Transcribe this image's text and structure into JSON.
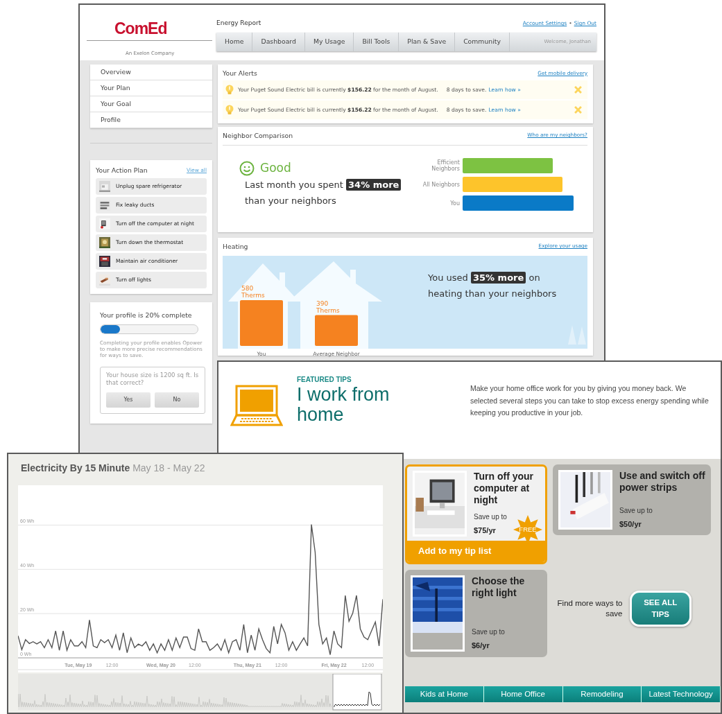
{
  "report_window": {
    "logo": {
      "name": "ComEd",
      "tagline": "An Exelon Company"
    },
    "title": "Energy Report",
    "account_links": [
      "Account Settings",
      "Sign Out"
    ],
    "link_separator": "•",
    "nav_tabs": [
      {
        "label": "Home",
        "selected": false
      },
      {
        "label": "Dashboard",
        "selected": false
      },
      {
        "label": "My Usage",
        "selected": false
      },
      {
        "label": "Bill Tools",
        "selected": false
      },
      {
        "label": "Plan & Save",
        "selected": false
      },
      {
        "label": "Community",
        "selected": false
      }
    ],
    "welcome": "Welcome, Jonathan",
    "side_nav": [
      "Overview",
      "Your Plan",
      "Your Goal",
      "Profile"
    ],
    "action_plan": {
      "title": "Your Action Plan",
      "view_all": "View all",
      "items": [
        "Unplug spare refrigerator",
        "Fix leaky ducts",
        "Turn off the computer at night",
        "Turn down the thermostat",
        "Maintain air conditioner",
        "Turn off lights"
      ]
    },
    "profile": {
      "status": "Your profile is 20% complete",
      "level": 0.2,
      "note": "Completing your profile enables Opower to make more precise recommendations for ways to save.",
      "question": "Your house size is 1200 sq ft. Is that correct?",
      "buttons": [
        "Yes",
        "No"
      ]
    },
    "alerts": {
      "title": "Your Alerts",
      "link": "Get mobile delivery",
      "items": [
        {
          "message": "Your Puget Sound Electric bill is currently **$156.22** for the month of August.",
          "countdown": "8 days to save.",
          "link": "Learn how »"
        },
        {
          "message": "Your Puget Sound Electric bill is currently **$156.22** for the month of August.",
          "countdown": "8 days to save.",
          "link": "Learn how »"
        }
      ]
    },
    "neighbor_comparison": {
      "title": "Neighbor Comparison",
      "link": "Who are my neighbors?",
      "rating": "Good",
      "summary": "Last month you spent **34% more** than your neighbors",
      "bars": [
        {
          "label": "Efficient Neighbors",
          "level": 0.72,
          "color": "#7dc242"
        },
        {
          "label": "All Neighbors",
          "level": 0.8,
          "color": "#fdc42b"
        },
        {
          "label": "You",
          "level": 0.89,
          "color": "#0a7ac7"
        }
      ]
    },
    "heating": {
      "title": "Heating",
      "link": "Explore your usage",
      "summary": "You used **35% more** on heating than your neighbors",
      "chart_data": {
        "type": "bar",
        "categories": [
          "You",
          "Average Neighbor"
        ],
        "values": [
          580,
          390
        ],
        "value_labels": [
          "580 Therms",
          "390 Therms"
        ]
      }
    }
  },
  "tips_window": {
    "eyebrow": "FEATURED TIPS",
    "title": "I work from home",
    "description": "Make your home office work for you by giving you money back. We selected several steps you can take to stop excess energy spending while keeping you productive in your job.",
    "tips": [
      {
        "title": "Turn off your computer at night",
        "save_label": "Save up to",
        "amount": "$75/yr",
        "badge": "FREE",
        "action": "Add to my tip list",
        "selected": true
      },
      {
        "title": "Use and switch off power strips",
        "save_label": "Save up to",
        "amount": "$50/yr",
        "selected": false
      },
      {
        "title": "Choose the right light",
        "save_label": "Save up to",
        "amount": "$6/yr",
        "selected": false
      }
    ],
    "more_text": "Find more ways to save",
    "more_button": "SEE ALL TIPS",
    "categories": [
      {
        "label": "Kids at Home",
        "selected": false
      },
      {
        "label": "Home Office",
        "selected": false
      },
      {
        "label": "Remodeling",
        "selected": false
      },
      {
        "label": "Latest Technology",
        "selected": false
      }
    ]
  },
  "chart_window": {
    "title": "Electricity By 15 Minute",
    "date_range": "May 18 - May 22",
    "chart_data": {
      "type": "line",
      "grid": true,
      "categories": [
        null,
        null,
        null,
        null,
        null,
        null,
        null,
        null,
        null,
        null,
        null,
        null,
        null,
        null,
        null,
        null,
        "Tue, May 19",
        null,
        null,
        null,
        null,
        null,
        null,
        null,
        null,
        "12:00",
        null,
        null,
        null,
        null,
        null,
        null,
        null,
        null,
        null,
        null,
        null,
        null,
        "Wed, May 20",
        null,
        null,
        null,
        null,
        null,
        null,
        null,
        null,
        "12:00",
        null,
        null,
        null,
        null,
        null,
        null,
        null,
        null,
        null,
        null,
        null,
        null,
        null,
        "Thu, May 21",
        null,
        null,
        null,
        null,
        null,
        null,
        null,
        null,
        "12:00",
        null,
        null,
        null,
        null,
        null,
        null,
        null,
        null,
        null,
        null,
        null,
        null,
        null,
        "Fri, May 22",
        null,
        null,
        null,
        null,
        null,
        null,
        null,
        null,
        "12:00",
        null,
        null,
        null,
        null
      ],
      "ylim": [
        0,
        78
      ],
      "yticks": [
        {
          "value": 0,
          "label": "0 Wh"
        },
        {
          "value": 20,
          "label": "20 Wh"
        },
        {
          "value": 40,
          "label": "40 Wh"
        },
        {
          "value": 60,
          "label": "60 Wh"
        }
      ],
      "series": [
        {
          "color": "#555555",
          "values": [
            10,
            3.7,
            8.2,
            6.5,
            7.3,
            6.3,
            7.3,
            4.6,
            8.2,
            4.6,
            12.2,
            3.4,
            12.2,
            3.4,
            8.2,
            5.4,
            5.4,
            7.3,
            4.6,
            17.1,
            5.4,
            4.6,
            8.2,
            6.9,
            8.2,
            4.6,
            10.3,
            3.4,
            11.3,
            2.3,
            9,
            4.6,
            6.2,
            5.4,
            7.3,
            3.4,
            6.3,
            2.3,
            6.3,
            3.4,
            8.2,
            3.4,
            9,
            4.6,
            9.4,
            9.4,
            4.2,
            3.4,
            13.1,
            7.3,
            7.3,
            3.4,
            4.6,
            6.3,
            3.4,
            8.2,
            2.3,
            7.3,
            8.2,
            3.4,
            15.1,
            2.3,
            10.3,
            3.4,
            13.1,
            8.2,
            4.2,
            2.3,
            14.2,
            6.3,
            15.1,
            11.3,
            3.4,
            7.3,
            3.4,
            6.3,
            9,
            5.4,
            60.3,
            47.7,
            15.1,
            6.3,
            9,
            1.4,
            12.2,
            6.3,
            4.6,
            28.2,
            16.5,
            20.2,
            28.2,
            13.1,
            9.4,
            8.2,
            12.2,
            16.2,
            5.4,
            26.5
          ]
        }
      ]
    }
  }
}
